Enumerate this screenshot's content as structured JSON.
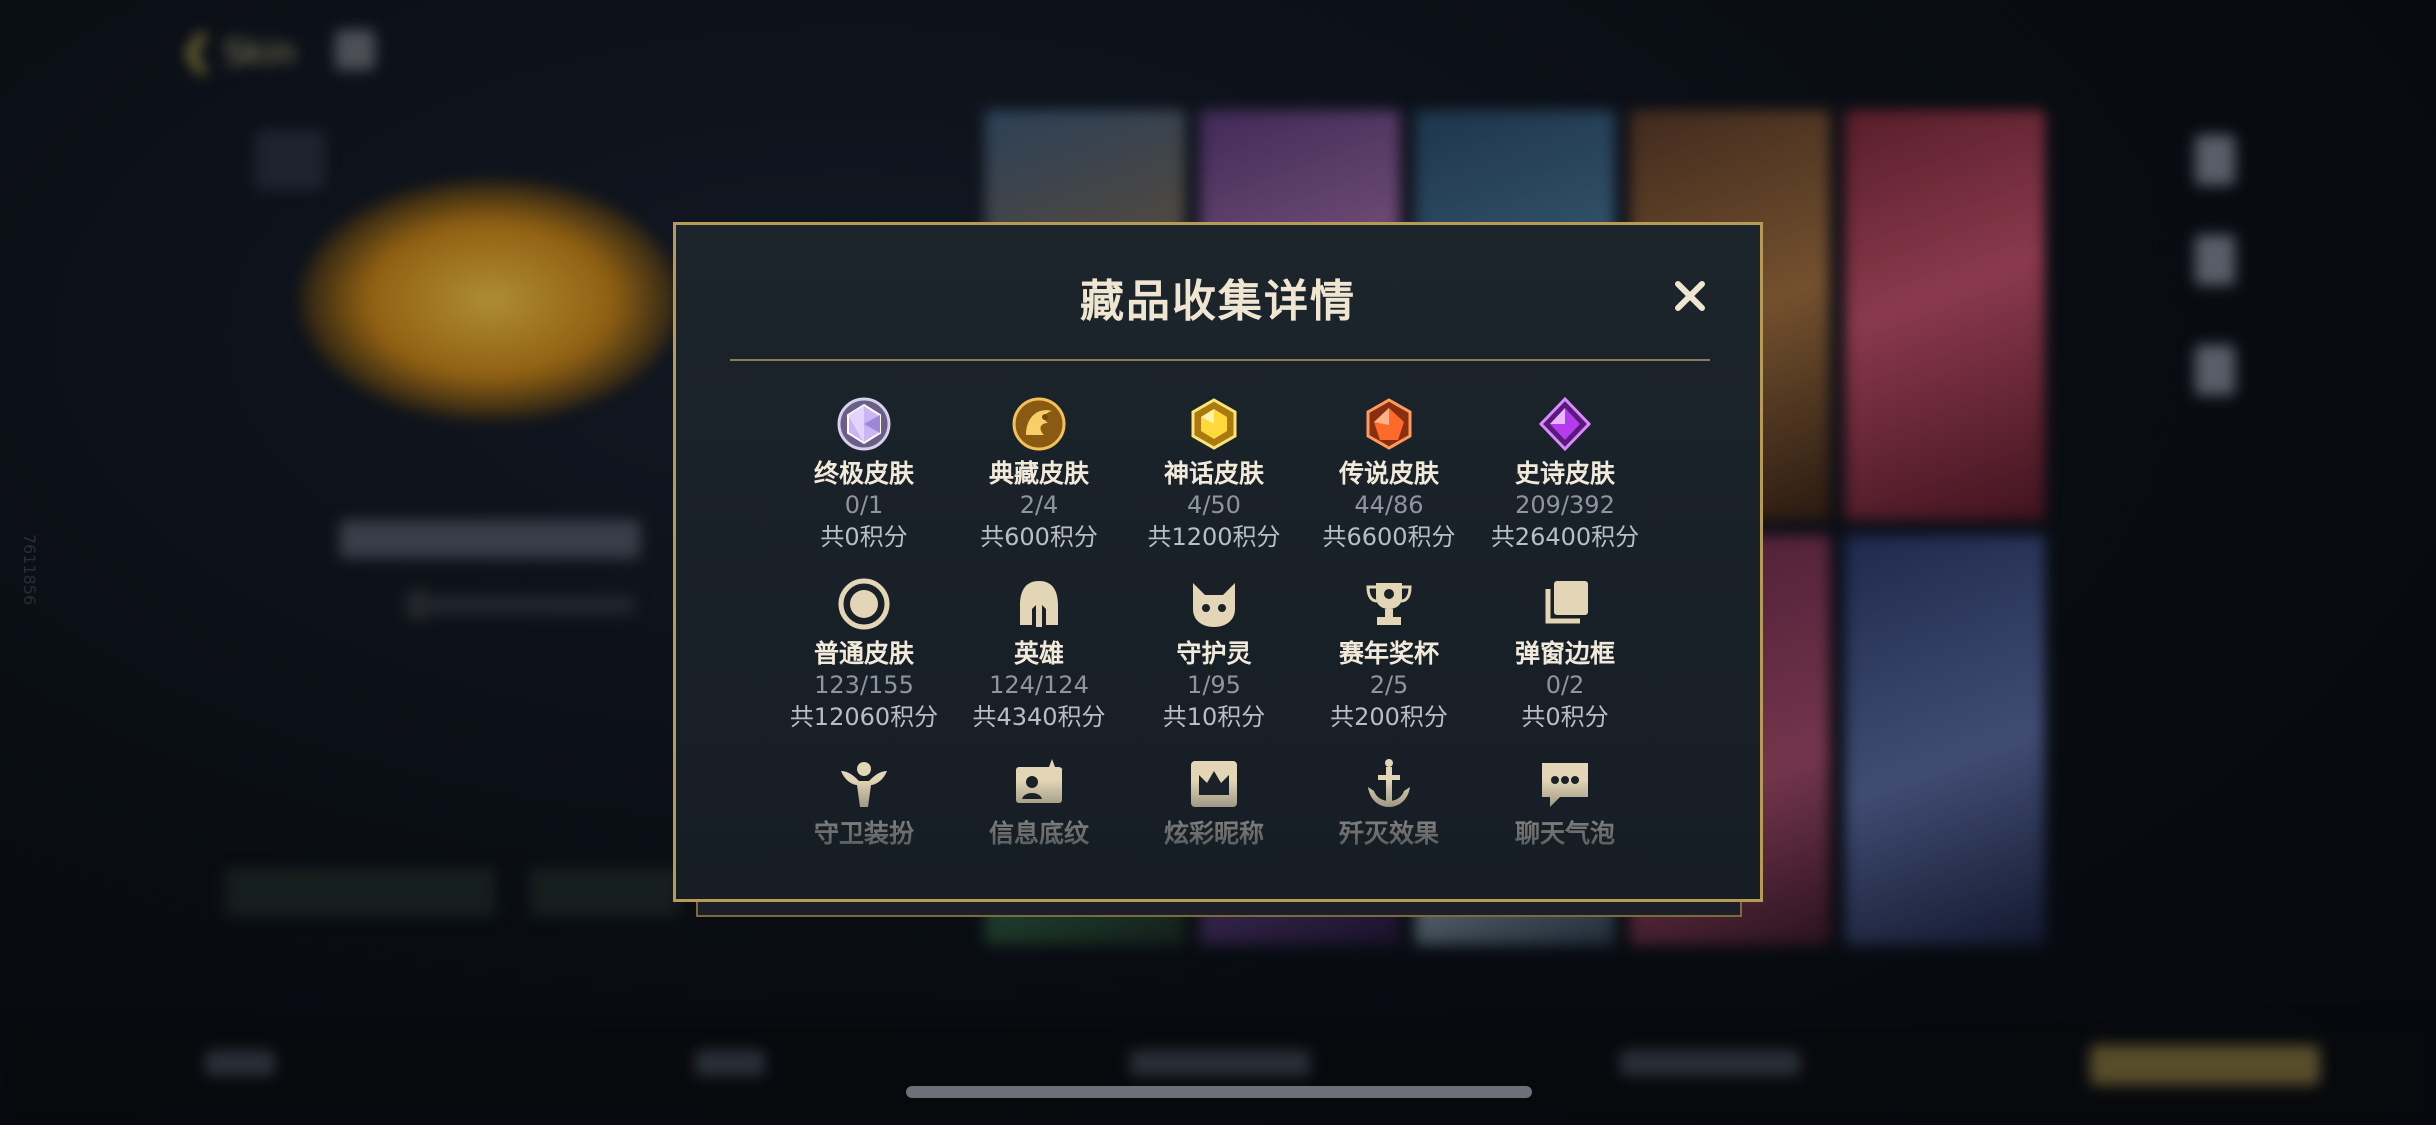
{
  "background": {
    "back_label": "Skin",
    "side_text": "7611856"
  },
  "modal": {
    "title": "藏品收集详情",
    "close_label": "✕",
    "rows": [
      [
        {
          "key": "ultimate",
          "icon": "ultimate-skin-gem-icon",
          "label": "终极皮肤",
          "count": "0/1",
          "points": "共0积分"
        },
        {
          "key": "prestige",
          "icon": "prestige-dragon-icon",
          "label": "典藏皮肤",
          "count": "2/4",
          "points": "共600积分"
        },
        {
          "key": "mythic",
          "icon": "mythic-gem-icon",
          "label": "神话皮肤",
          "count": "4/50",
          "points": "共1200积分"
        },
        {
          "key": "legendary",
          "icon": "legendary-gem-icon",
          "label": "传说皮肤",
          "count": "44/86",
          "points": "共6600积分"
        },
        {
          "key": "epic",
          "icon": "epic-gem-icon",
          "label": "史诗皮肤",
          "count": "209/392",
          "points": "共26400积分"
        }
      ],
      [
        {
          "key": "normal",
          "icon": "normal-skin-ring-icon",
          "label": "普通皮肤",
          "count": "123/155",
          "points": "共12060积分"
        },
        {
          "key": "hero",
          "icon": "helmet-icon",
          "label": "英雄",
          "count": "124/124",
          "points": "共4340积分"
        },
        {
          "key": "guardian",
          "icon": "guardian-creature-icon",
          "label": "守护灵",
          "count": "1/95",
          "points": "共10积分"
        },
        {
          "key": "trophy",
          "icon": "trophy-icon",
          "label": "赛年奖杯",
          "count": "2/5",
          "points": "共200积分"
        },
        {
          "key": "popup",
          "icon": "popup-frame-icon",
          "label": "弹窗边框",
          "count": "0/2",
          "points": "共0积分"
        }
      ],
      [
        {
          "key": "ward",
          "icon": "ward-skin-icon",
          "label": "守卫装扮"
        },
        {
          "key": "banner",
          "icon": "profile-banner-icon",
          "label": "信息底纹"
        },
        {
          "key": "nickname",
          "icon": "crown-nameplate-icon",
          "label": "炫彩昵称"
        },
        {
          "key": "execution",
          "icon": "anchor-effect-icon",
          "label": "歼灭效果"
        },
        {
          "key": "chat",
          "icon": "chat-bubble-icon",
          "label": "聊天气泡"
        }
      ]
    ]
  },
  "colors": {
    "frame_gold": "#b89a57",
    "title_text": "#efe6d2",
    "count_text": "#8e95a0",
    "points_text": "#b9bec6"
  }
}
